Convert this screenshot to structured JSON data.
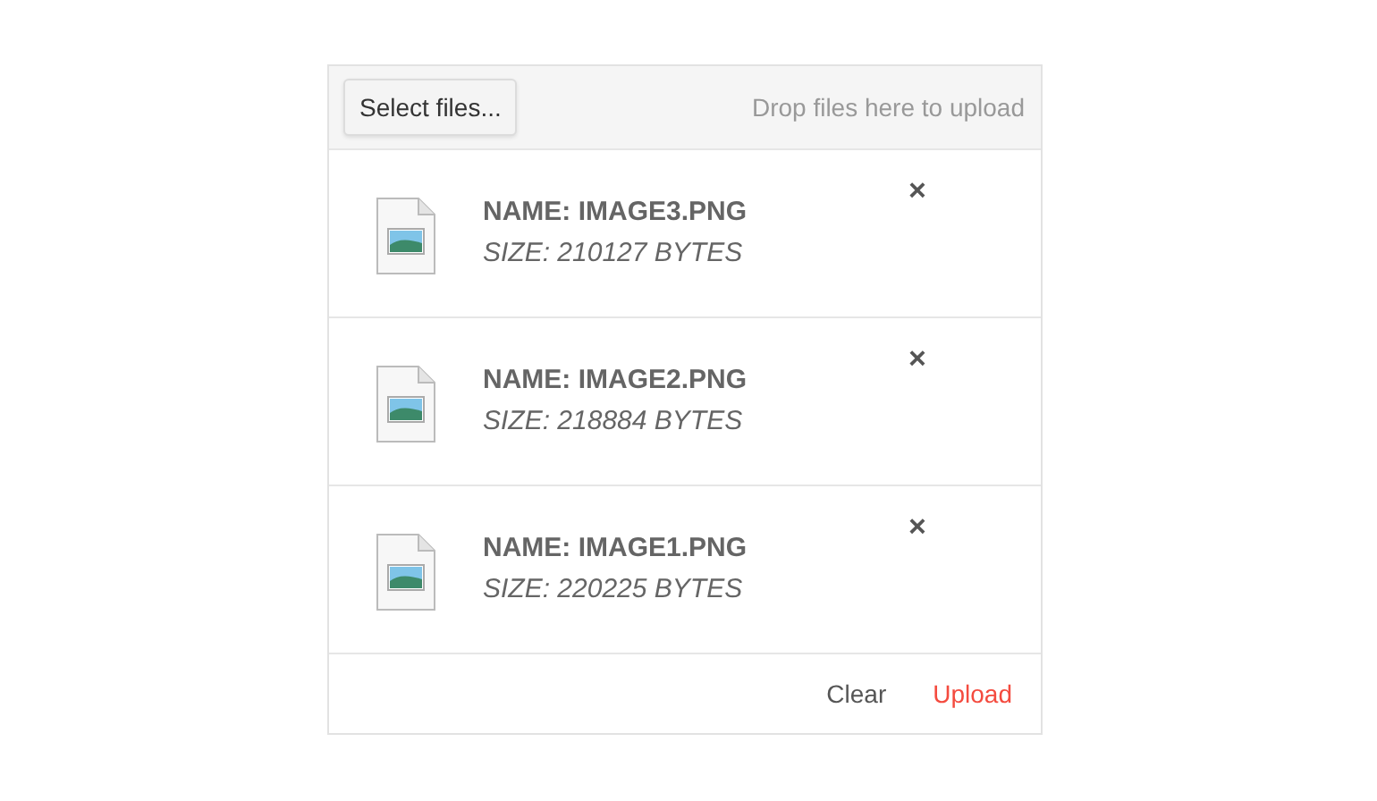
{
  "toolbar": {
    "select_button": "Select files...",
    "drop_hint": "Drop files here to upload"
  },
  "files": [
    {
      "name": "NAME: IMAGE3.PNG",
      "size": "SIZE: 210127 BYTES",
      "remove": "×"
    },
    {
      "name": "NAME: IMAGE2.PNG",
      "size": "SIZE: 218884 BYTES",
      "remove": "×"
    },
    {
      "name": "NAME: IMAGE1.PNG",
      "size": "SIZE: 220225 BYTES",
      "remove": "×"
    }
  ],
  "actions": [
    {
      "label": "Clear",
      "kind": "secondary"
    },
    {
      "label": "Upload",
      "kind": "primary"
    }
  ]
}
